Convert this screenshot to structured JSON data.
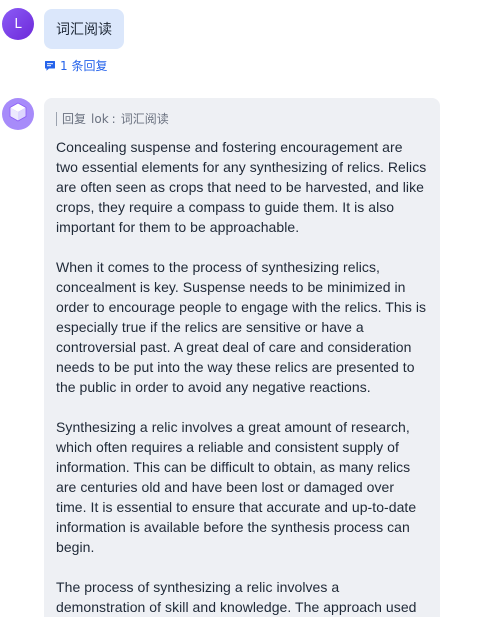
{
  "user": {
    "avatar_letter": "L",
    "avatar_color": "#7c3aed",
    "message": "词汇阅读",
    "replies": "1 条回复"
  },
  "bot": {
    "avatar_icon": "cube-icon",
    "reply_prefix": "回复",
    "reply_user": "lok",
    "reply_sep": ":",
    "reply_quote": "词汇阅读",
    "paragraphs": [
      "Concealing suspense and fostering encouragement are two essential elements for any synthesizing of relics. Relics are often seen as crops that need to be harvested, and like crops, they require a compass to guide them. It is also important for them to be approachable.",
      "When it comes to the process of synthesizing relics, concealment is key. Suspense needs to be minimized in order to encourage people to engage with the relics. This is especially true if the relics are sensitive or have a controversial past. A great deal of care and consideration needs to be put into the way these relics are presented to the public in order to avoid any negative reactions.",
      "Synthesizing a relic involves a great amount of research, which often requires a reliable and consistent supply of information. This can be difficult to obtain, as many relics are centuries old and have been lost or damaged over time. It is essential to ensure that accurate and up-to-date information is available before the synthesis process can begin.",
      "The process of synthesizing a relic involves a demonstration of skill and knowledge. The approach used to synthesize"
    ]
  },
  "colors": {
    "accent": "#2563eb",
    "user_bubble": "#dbe7fb",
    "bot_bubble": "#eef0f4"
  }
}
